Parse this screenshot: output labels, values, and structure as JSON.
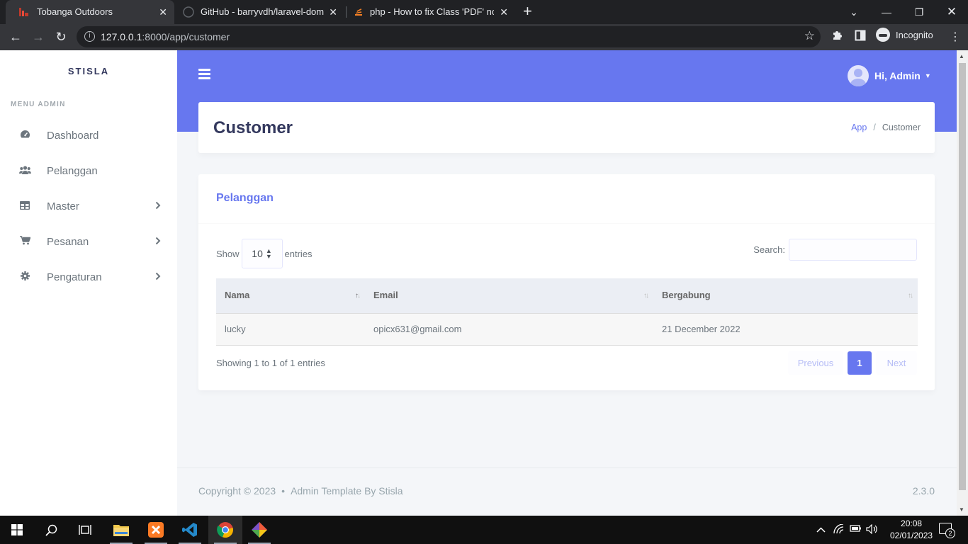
{
  "browser": {
    "tabs": [
      {
        "title": "Tobanga Outdoors",
        "active": true
      },
      {
        "title": "GitHub - barryvdh/laravel-dompd",
        "active": false
      },
      {
        "title": "php - How to fix Class 'PDF' not f",
        "active": false
      }
    ],
    "url_host": "127.0.0.1",
    "url_path": ":8000/app/customer",
    "profile_label": "Incognito"
  },
  "sidebar": {
    "brand": "STISLA",
    "menu_header": "MENU ADMIN",
    "items": [
      {
        "label": "Dashboard",
        "icon": "tachometer-icon",
        "has_arrow": false
      },
      {
        "label": "Pelanggan",
        "icon": "users-icon",
        "has_arrow": false
      },
      {
        "label": "Master",
        "icon": "table-icon",
        "has_arrow": true
      },
      {
        "label": "Pesanan",
        "icon": "cart-icon",
        "has_arrow": true
      },
      {
        "label": "Pengaturan",
        "icon": "cog-icon",
        "has_arrow": true
      }
    ]
  },
  "navbar": {
    "user_greeting": "Hi, Admin"
  },
  "page": {
    "title": "Customer",
    "breadcrumb": [
      "App",
      "Customer"
    ],
    "card_title": "Pelanggan",
    "length_prefix": "Show",
    "length_value": "10",
    "length_suffix": "entries",
    "search_label": "Search:",
    "table": {
      "columns": [
        "Nama",
        "Email",
        "Bergabung"
      ],
      "rows": [
        [
          "lucky",
          "opicx631@gmail.com",
          "21 December 2022"
        ]
      ]
    },
    "info": "Showing 1 to 1 of 1 entries",
    "pagination": {
      "previous": "Previous",
      "current": "1",
      "next": "Next"
    }
  },
  "footer": {
    "copyright": "Copyright © 2023",
    "separator": "•",
    "credit": "Admin Template By Stisla",
    "version": "2.3.0"
  },
  "taskbar": {
    "time": "20:08",
    "date": "02/01/2023",
    "notification_count": "2"
  },
  "colors": {
    "primary": "#6777ef",
    "body_bg": "#f4f6f9",
    "heading": "#34395e"
  }
}
